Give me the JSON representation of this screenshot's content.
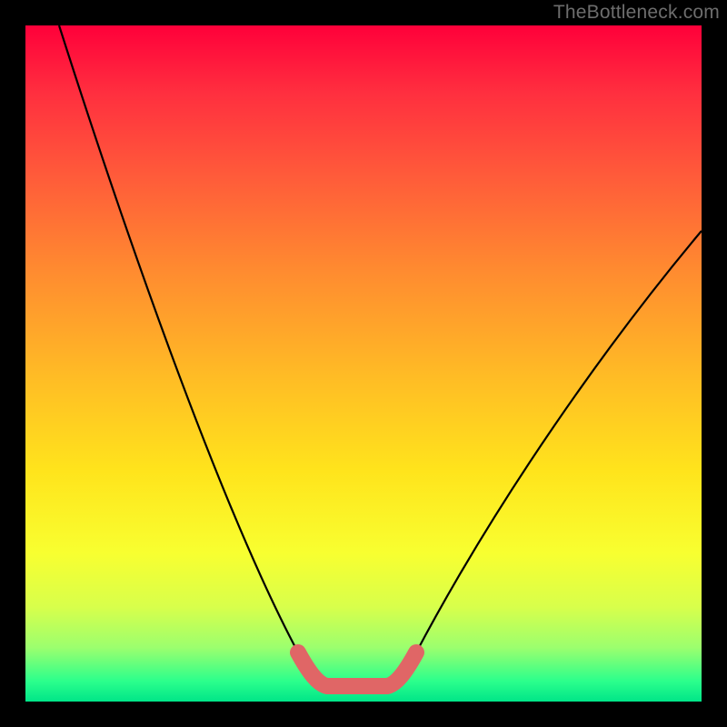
{
  "watermark": "TheBottleneck.com",
  "chart_data": {
    "type": "line",
    "title": "",
    "xlabel": "",
    "ylabel": "",
    "xlim": [
      0,
      100
    ],
    "ylim": [
      0,
      100
    ],
    "series": [
      {
        "name": "bottleneck-curve-left",
        "x": [
          5,
          10,
          15,
          20,
          25,
          30,
          35,
          40,
          43
        ],
        "values": [
          100,
          87,
          75,
          62,
          49,
          36,
          23,
          10,
          2
        ]
      },
      {
        "name": "bottleneck-curve-right",
        "x": [
          55,
          60,
          65,
          70,
          75,
          80,
          85,
          90,
          95,
          100
        ],
        "values": [
          2,
          8,
          15,
          23,
          31,
          39,
          47,
          55,
          62,
          70
        ]
      },
      {
        "name": "flat-segment",
        "x": [
          43,
          44,
          46,
          49,
          52,
          54,
          55
        ],
        "values": [
          3.5,
          2.2,
          1.8,
          1.7,
          1.8,
          2.2,
          3.5
        ]
      }
    ],
    "annotations": []
  }
}
